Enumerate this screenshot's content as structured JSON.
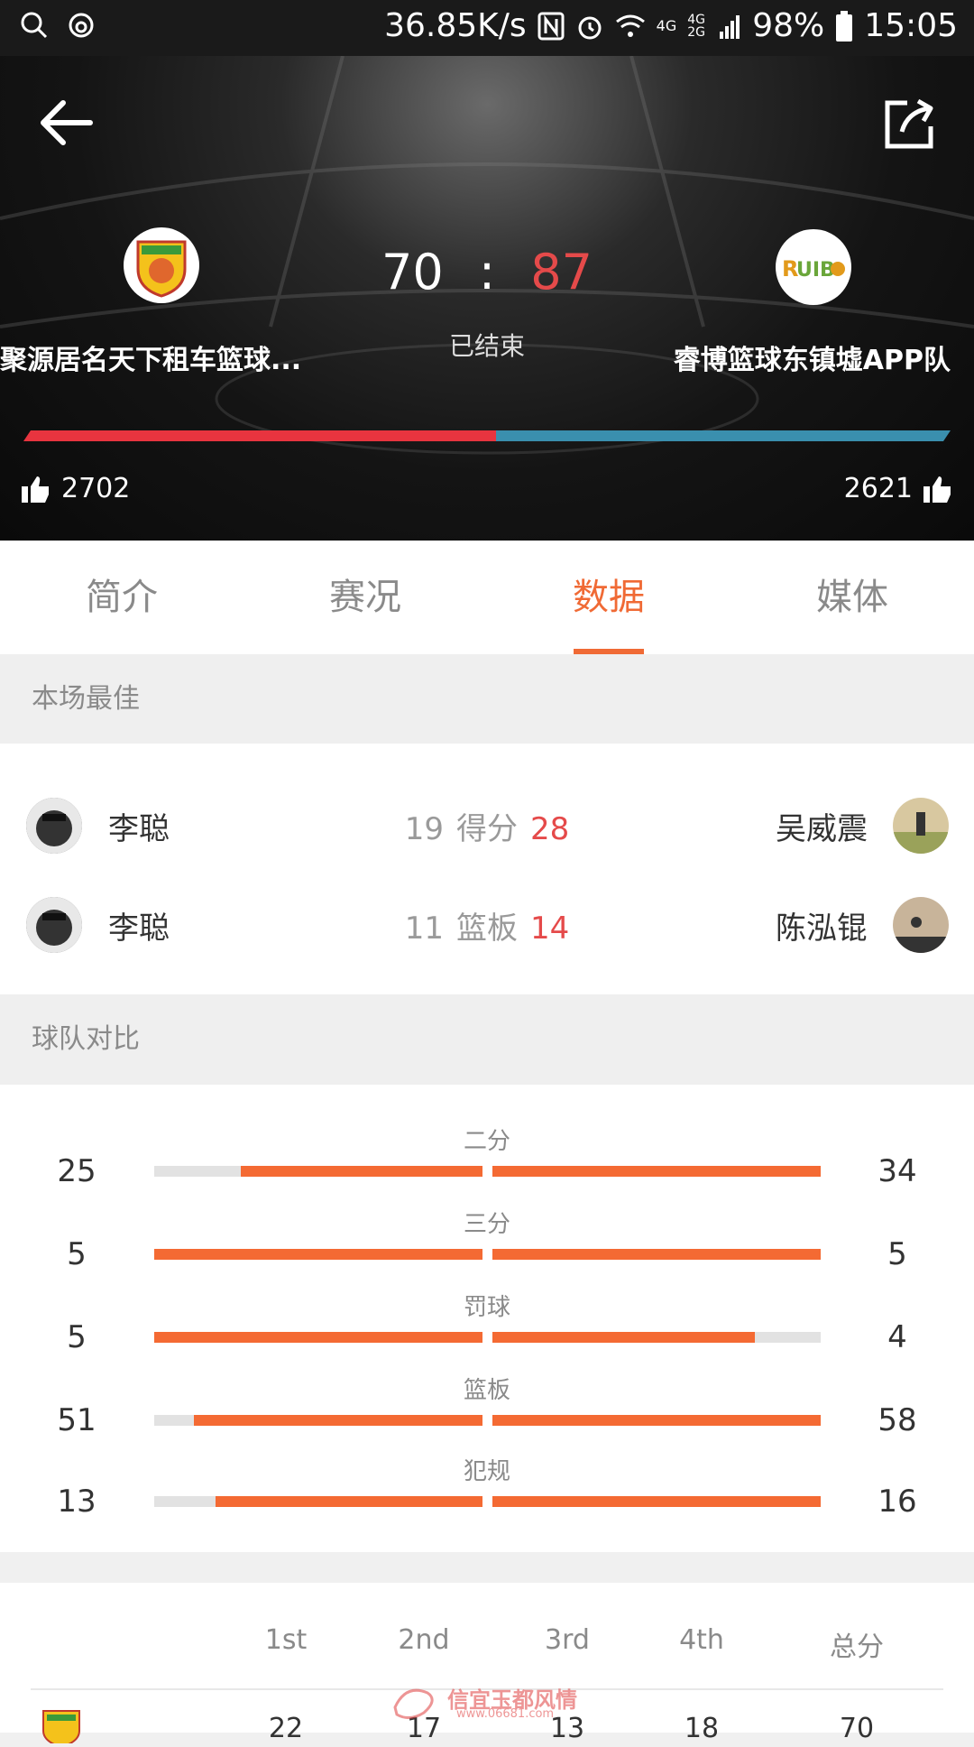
{
  "status_bar": {
    "net_speed": "36.85K/s",
    "network": "4G",
    "network2": "4G 2G",
    "battery": "98%",
    "time": "15:05"
  },
  "match": {
    "home_team": "聚源居名天下租车篮球...",
    "away_team": "睿博篮球东镇墟APP队",
    "home_score": "70",
    "separator": ":",
    "away_score": "87",
    "status": "已结束",
    "home_likes": "2702",
    "away_likes": "2621",
    "like_share_home": 0.51
  },
  "tabs": [
    "简介",
    "赛况",
    "数据",
    "媒体"
  ],
  "active_tab": "数据",
  "best": {
    "title": "本场最佳",
    "rows": [
      {
        "home_player": "李聪",
        "home_value": "19",
        "label": "得分",
        "away_value": "28",
        "away_player": "吴威震"
      },
      {
        "home_player": "李聪",
        "home_value": "11",
        "label": "篮板",
        "away_value": "14",
        "away_player": "陈泓锟"
      }
    ]
  },
  "compare": {
    "title": "球队对比",
    "rows": [
      {
        "label": "二分",
        "home": "25",
        "away": "34",
        "home_frac": 0.735,
        "away_frac": 1.0
      },
      {
        "label": "三分",
        "home": "5",
        "away": "5",
        "home_frac": 1.0,
        "away_frac": 1.0
      },
      {
        "label": "罚球",
        "home": "5",
        "away": "4",
        "home_frac": 1.0,
        "away_frac": 0.8
      },
      {
        "label": "篮板",
        "home": "51",
        "away": "58",
        "home_frac": 0.879,
        "away_frac": 1.0
      },
      {
        "label": "犯规",
        "home": "13",
        "away": "16",
        "home_frac": 0.8125,
        "away_frac": 1.0
      }
    ]
  },
  "quarters": {
    "headers": [
      "1st",
      "2nd",
      "3rd",
      "4th",
      "总分"
    ],
    "home_row": [
      "22",
      "17",
      "13",
      "18",
      "70"
    ]
  },
  "watermark": "信宜玉都风情",
  "watermark_url": "www.06681.com",
  "colors": {
    "accent": "#f06a35",
    "home_bar": "#e8343f",
    "away_bar": "#3a8fae",
    "away_score": "#e54a4a"
  }
}
